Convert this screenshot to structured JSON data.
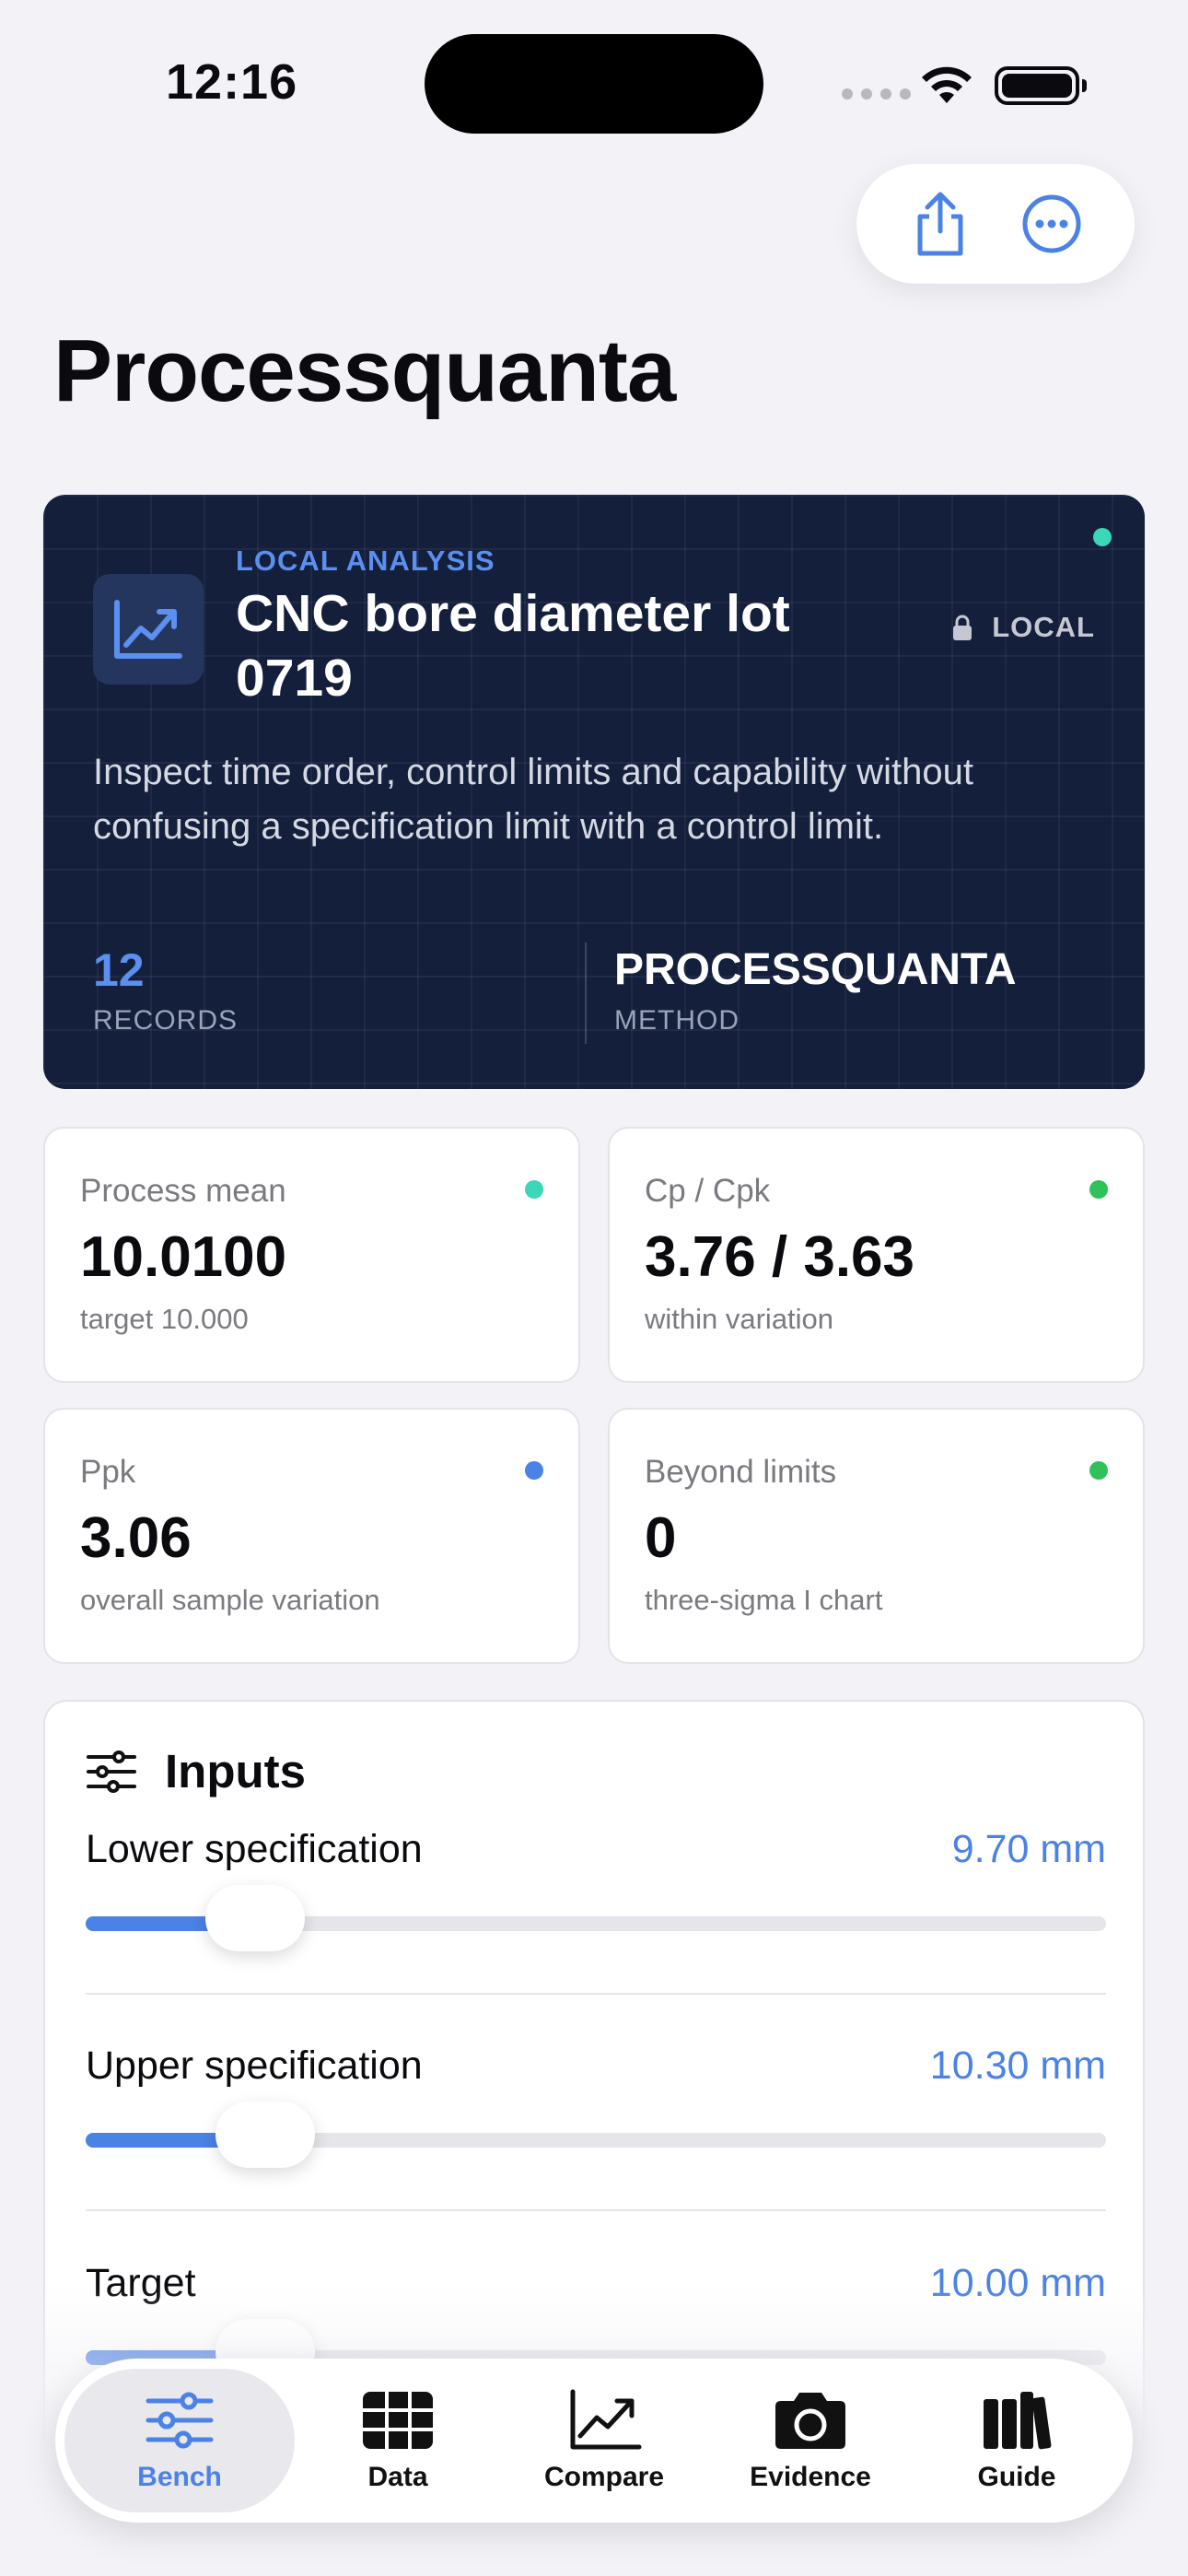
{
  "status_bar": {
    "time": "12:16"
  },
  "page": {
    "title": "Processquanta"
  },
  "hero": {
    "eyebrow": "LOCAL ANALYSIS",
    "title": "CNC bore diameter lot 0719",
    "badge": "LOCAL",
    "description": "Inspect time order, control limits and capability without confusing a specification limit with a control limit.",
    "records_value": "12",
    "records_label": "RECORDS",
    "method_value": "PROCESSQUANTA",
    "method_label": "METHOD"
  },
  "metrics": [
    {
      "label": "Process mean",
      "value": "10.0100",
      "sub": "target 10.000",
      "dot": "#3cd6b8"
    },
    {
      "label": "Cp / Cpk",
      "value": "3.76 / 3.63",
      "sub": "within variation",
      "dot": "#2fc25b"
    },
    {
      "label": "Ppk",
      "value": "3.06",
      "sub": "overall sample variation",
      "dot": "#4b82e6"
    },
    {
      "label": "Beyond limits",
      "value": "0",
      "sub": "three-sigma I chart",
      "dot": "#2fc25b"
    }
  ],
  "inputs": {
    "title": "Inputs",
    "rows": [
      {
        "label": "Lower specification",
        "value": "9.70 mm",
        "level": 0.13
      },
      {
        "label": "Upper specification",
        "value": "10.30 mm",
        "level": 0.14
      },
      {
        "label": "Target",
        "value": "10.00 mm",
        "level": 0.14
      }
    ]
  },
  "tabs": [
    {
      "label": "Bench",
      "icon": "sliders-icon",
      "active": true
    },
    {
      "label": "Data",
      "icon": "table-icon"
    },
    {
      "label": "Compare",
      "icon": "chart-icon"
    },
    {
      "label": "Evidence",
      "icon": "camera-icon"
    },
    {
      "label": "Guide",
      "icon": "books-icon"
    }
  ],
  "colors": {
    "accent": "#4b82e6",
    "hero_bg": "#141f3c",
    "teal": "#3cd6b8",
    "green": "#2fc25b"
  }
}
